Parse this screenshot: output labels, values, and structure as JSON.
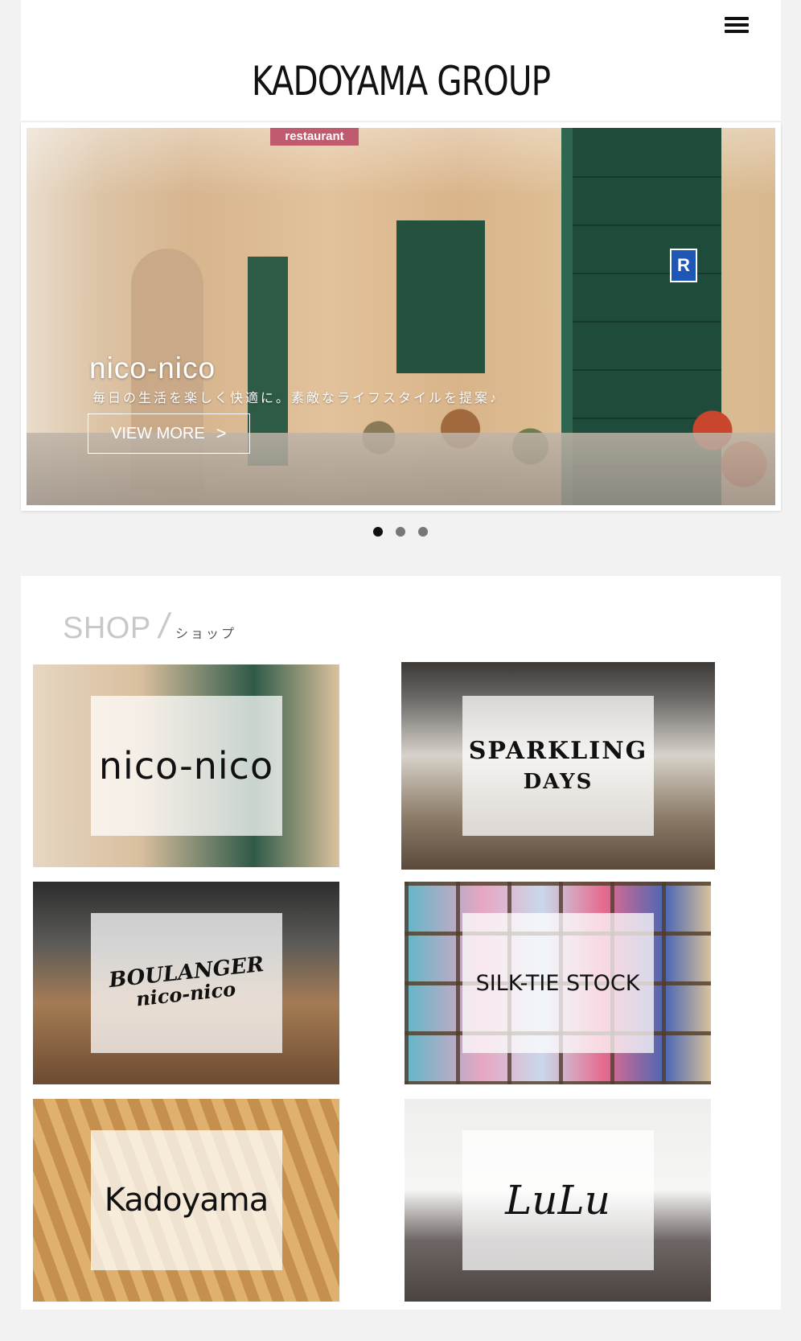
{
  "header": {
    "logo_text": "KADOYAMA GROUP",
    "menu_icon": "hamburger-menu-icon"
  },
  "hero": {
    "title": "nico-nico",
    "subtitle": "毎日の生活を楽しく快適に。素敵なライフスタイルを提案♪",
    "cta_label": "VIEW MORE",
    "cta_icon": "chevron-right-icon",
    "sign_restaurant": "restaurant",
    "sign_r": "R",
    "slide_count": 3,
    "active_slide": 1
  },
  "shop": {
    "heading_en": "SHOP",
    "heading_sep": "/",
    "heading_ja": "ショップ",
    "tiles": [
      {
        "label": "nico-nico"
      },
      {
        "label": "SPARKLING",
        "label2": "DAYS"
      },
      {
        "label": "BOULANGER",
        "label2": "nico-nico"
      },
      {
        "label": "SILK-TIE STOCK"
      },
      {
        "label": "Kadoyama"
      },
      {
        "label": "LuLu"
      }
    ]
  }
}
